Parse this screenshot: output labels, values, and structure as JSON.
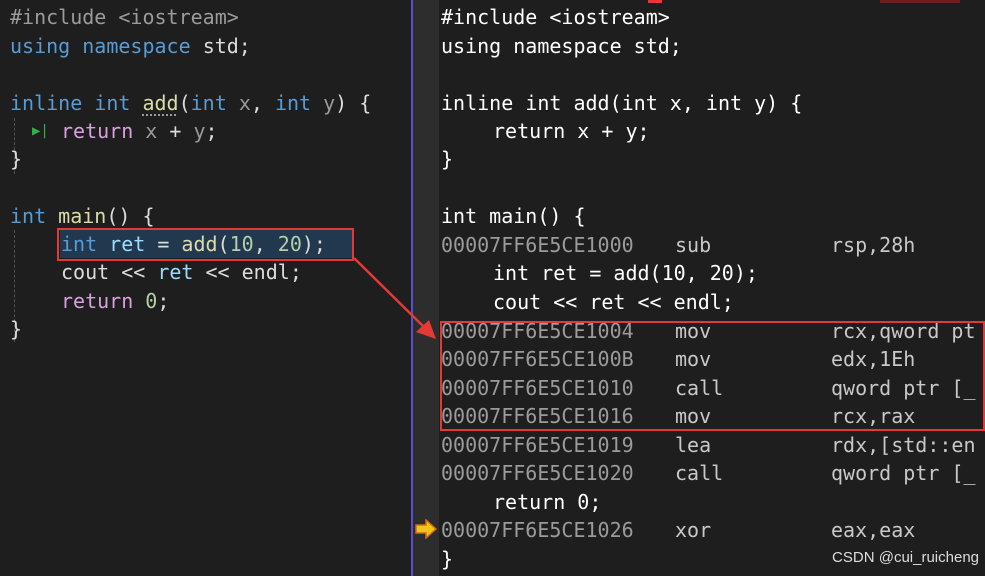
{
  "left": {
    "lines": [
      "#include <iostream>",
      "using namespace std;",
      "inline int add(int x, int y) {",
      "return x + y;",
      "}",
      "int main() {",
      "int ret = add(10, 20);",
      "cout << ret << endl;",
      "return 0;",
      "}"
    ],
    "tokens": {
      "include": "#include",
      "iostream": "<iostream>",
      "using": "using",
      "namespace": "namespace",
      "std": "std;",
      "inline": "inline",
      "int": "int",
      "add": "add",
      "x": "x",
      "y": "y",
      "return": "return",
      "main": "main",
      "ret": "ret",
      "cout": "cout",
      "endl": "endl",
      "n10": "10",
      "n20": "20",
      "n0": "0"
    }
  },
  "right": {
    "source": {
      "include": "#include <iostream>",
      "using": "using namespace std;",
      "add_sig": "inline int add(int x, int y) {",
      "add_ret": "return x + y;",
      "close1": "}",
      "main_sig": "int main() {",
      "ret_line": "int ret = add(10, 20);",
      "cout_line": "cout << ret << endl;",
      "return_line": "return 0;",
      "close2": "}"
    },
    "disasm": [
      {
        "addr": "00007FF6E5CE1000",
        "op": "sub",
        "args": "rsp,28h"
      },
      {
        "addr": "00007FF6E5CE1004",
        "op": "mov",
        "args": "rcx,qword pt"
      },
      {
        "addr": "00007FF6E5CE100B",
        "op": "mov",
        "args": "edx,1Eh"
      },
      {
        "addr": "00007FF6E5CE1010",
        "op": "call",
        "args": "qword ptr [_"
      },
      {
        "addr": "00007FF6E5CE1016",
        "op": "mov",
        "args": "rcx,rax"
      },
      {
        "addr": "00007FF6E5CE1019",
        "op": "lea",
        "args": "rdx,[std::en"
      },
      {
        "addr": "00007FF6E5CE1020",
        "op": "call",
        "args": "qword ptr [_"
      },
      {
        "addr": "00007FF6E5CE1026",
        "op": "xor",
        "args": "eax,eax"
      }
    ]
  },
  "icons": {
    "step_marker": "step-into-icon",
    "instruction_pointer": "instruction-pointer-icon"
  },
  "colors": {
    "keyword": "#569cd6",
    "control": "#d8a0df",
    "function": "#dcdcaa",
    "number": "#b5cea8",
    "highlight_box": "#e53935",
    "divider": "#5a4fc9"
  },
  "watermark": "CSDN @cui_ruicheng"
}
